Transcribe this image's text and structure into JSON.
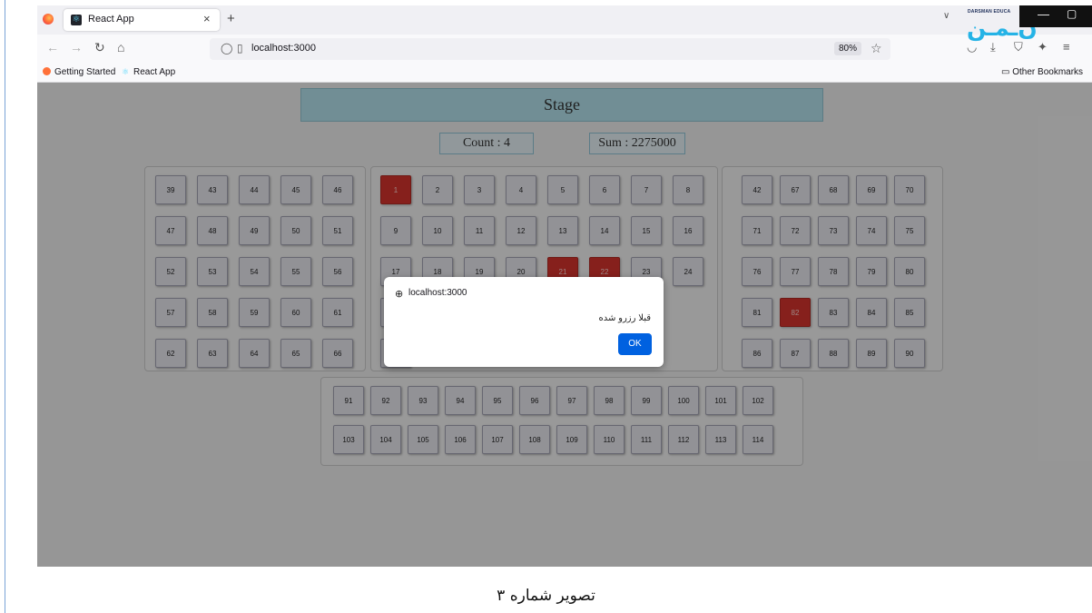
{
  "browser": {
    "tab_title": "React App",
    "tab_close": "×",
    "new_tab": "+",
    "tab_dropdown": "∨",
    "url": "localhost:3000",
    "zoom": "80%",
    "bookmarks": [
      {
        "label": "Getting Started",
        "icon": "firefox-icon"
      },
      {
        "label": "React App",
        "icon": "react-icon"
      }
    ],
    "other_bookmarks": "Other Bookmarks",
    "brand_small": "DARSMAN EDUCA",
    "brand_big": "ن‌ـمـن"
  },
  "app": {
    "stage_label": "Stage",
    "count_label": "Count : 4",
    "sum_label": "Sum : 2275000",
    "reserved_color": "#d9352e",
    "seat_color": "#ececf3",
    "sections": [
      {
        "name": "left",
        "rows": [
          [
            39,
            43,
            44,
            45,
            46
          ],
          [
            47,
            48,
            49,
            50,
            51
          ],
          [
            52,
            53,
            54,
            55,
            56
          ],
          [
            57,
            58,
            59,
            60,
            61
          ],
          [
            62,
            63,
            64,
            65,
            66
          ]
        ]
      },
      {
        "name": "center",
        "rows": [
          [
            1,
            2,
            3,
            4,
            5,
            6,
            7,
            8
          ],
          [
            9,
            10,
            11,
            12,
            13,
            14,
            15,
            16
          ],
          [
            17,
            18,
            19,
            20,
            21,
            22,
            23,
            24
          ],
          [
            25
          ],
          [
            33
          ]
        ]
      },
      {
        "name": "right",
        "rows": [
          [
            42,
            67,
            68,
            69,
            70
          ],
          [
            71,
            72,
            73,
            74,
            75
          ],
          [
            76,
            77,
            78,
            79,
            80
          ],
          [
            81,
            82,
            83,
            84,
            85
          ],
          [
            86,
            87,
            88,
            89,
            90
          ]
        ]
      },
      {
        "name": "bottom",
        "rows": [
          [
            91,
            92,
            93,
            94,
            95,
            96,
            97,
            98,
            99,
            100,
            101,
            102
          ],
          [
            103,
            104,
            105,
            106,
            107,
            108,
            109,
            110,
            111,
            112,
            113,
            114
          ]
        ]
      }
    ],
    "reserved": [
      1,
      21,
      22,
      82
    ]
  },
  "dialog": {
    "origin": "localhost:3000",
    "message": "قبلا رزرو شده",
    "ok_label": "OK"
  },
  "caption": "تصویر شماره ۳"
}
